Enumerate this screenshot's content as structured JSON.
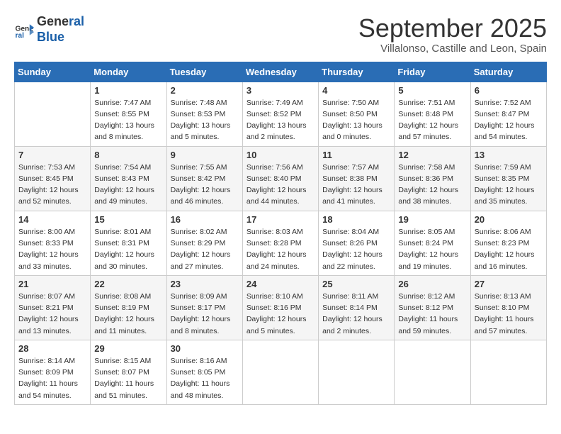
{
  "header": {
    "logo_line1": "General",
    "logo_line2": "Blue",
    "month_title": "September 2025",
    "subtitle": "Villalonso, Castille and Leon, Spain"
  },
  "weekdays": [
    "Sunday",
    "Monday",
    "Tuesday",
    "Wednesday",
    "Thursday",
    "Friday",
    "Saturday"
  ],
  "weeks": [
    [
      {
        "day": "",
        "info": ""
      },
      {
        "day": "1",
        "info": "Sunrise: 7:47 AM\nSunset: 8:55 PM\nDaylight: 13 hours\nand 8 minutes."
      },
      {
        "day": "2",
        "info": "Sunrise: 7:48 AM\nSunset: 8:53 PM\nDaylight: 13 hours\nand 5 minutes."
      },
      {
        "day": "3",
        "info": "Sunrise: 7:49 AM\nSunset: 8:52 PM\nDaylight: 13 hours\nand 2 minutes."
      },
      {
        "day": "4",
        "info": "Sunrise: 7:50 AM\nSunset: 8:50 PM\nDaylight: 13 hours\nand 0 minutes."
      },
      {
        "day": "5",
        "info": "Sunrise: 7:51 AM\nSunset: 8:48 PM\nDaylight: 12 hours\nand 57 minutes."
      },
      {
        "day": "6",
        "info": "Sunrise: 7:52 AM\nSunset: 8:47 PM\nDaylight: 12 hours\nand 54 minutes."
      }
    ],
    [
      {
        "day": "7",
        "info": "Sunrise: 7:53 AM\nSunset: 8:45 PM\nDaylight: 12 hours\nand 52 minutes."
      },
      {
        "day": "8",
        "info": "Sunrise: 7:54 AM\nSunset: 8:43 PM\nDaylight: 12 hours\nand 49 minutes."
      },
      {
        "day": "9",
        "info": "Sunrise: 7:55 AM\nSunset: 8:42 PM\nDaylight: 12 hours\nand 46 minutes."
      },
      {
        "day": "10",
        "info": "Sunrise: 7:56 AM\nSunset: 8:40 PM\nDaylight: 12 hours\nand 44 minutes."
      },
      {
        "day": "11",
        "info": "Sunrise: 7:57 AM\nSunset: 8:38 PM\nDaylight: 12 hours\nand 41 minutes."
      },
      {
        "day": "12",
        "info": "Sunrise: 7:58 AM\nSunset: 8:36 PM\nDaylight: 12 hours\nand 38 minutes."
      },
      {
        "day": "13",
        "info": "Sunrise: 7:59 AM\nSunset: 8:35 PM\nDaylight: 12 hours\nand 35 minutes."
      }
    ],
    [
      {
        "day": "14",
        "info": "Sunrise: 8:00 AM\nSunset: 8:33 PM\nDaylight: 12 hours\nand 33 minutes."
      },
      {
        "day": "15",
        "info": "Sunrise: 8:01 AM\nSunset: 8:31 PM\nDaylight: 12 hours\nand 30 minutes."
      },
      {
        "day": "16",
        "info": "Sunrise: 8:02 AM\nSunset: 8:29 PM\nDaylight: 12 hours\nand 27 minutes."
      },
      {
        "day": "17",
        "info": "Sunrise: 8:03 AM\nSunset: 8:28 PM\nDaylight: 12 hours\nand 24 minutes."
      },
      {
        "day": "18",
        "info": "Sunrise: 8:04 AM\nSunset: 8:26 PM\nDaylight: 12 hours\nand 22 minutes."
      },
      {
        "day": "19",
        "info": "Sunrise: 8:05 AM\nSunset: 8:24 PM\nDaylight: 12 hours\nand 19 minutes."
      },
      {
        "day": "20",
        "info": "Sunrise: 8:06 AM\nSunset: 8:23 PM\nDaylight: 12 hours\nand 16 minutes."
      }
    ],
    [
      {
        "day": "21",
        "info": "Sunrise: 8:07 AM\nSunset: 8:21 PM\nDaylight: 12 hours\nand 13 minutes."
      },
      {
        "day": "22",
        "info": "Sunrise: 8:08 AM\nSunset: 8:19 PM\nDaylight: 12 hours\nand 11 minutes."
      },
      {
        "day": "23",
        "info": "Sunrise: 8:09 AM\nSunset: 8:17 PM\nDaylight: 12 hours\nand 8 minutes."
      },
      {
        "day": "24",
        "info": "Sunrise: 8:10 AM\nSunset: 8:16 PM\nDaylight: 12 hours\nand 5 minutes."
      },
      {
        "day": "25",
        "info": "Sunrise: 8:11 AM\nSunset: 8:14 PM\nDaylight: 12 hours\nand 2 minutes."
      },
      {
        "day": "26",
        "info": "Sunrise: 8:12 AM\nSunset: 8:12 PM\nDaylight: 11 hours\nand 59 minutes."
      },
      {
        "day": "27",
        "info": "Sunrise: 8:13 AM\nSunset: 8:10 PM\nDaylight: 11 hours\nand 57 minutes."
      }
    ],
    [
      {
        "day": "28",
        "info": "Sunrise: 8:14 AM\nSunset: 8:09 PM\nDaylight: 11 hours\nand 54 minutes."
      },
      {
        "day": "29",
        "info": "Sunrise: 8:15 AM\nSunset: 8:07 PM\nDaylight: 11 hours\nand 51 minutes."
      },
      {
        "day": "30",
        "info": "Sunrise: 8:16 AM\nSunset: 8:05 PM\nDaylight: 11 hours\nand 48 minutes."
      },
      {
        "day": "",
        "info": ""
      },
      {
        "day": "",
        "info": ""
      },
      {
        "day": "",
        "info": ""
      },
      {
        "day": "",
        "info": ""
      }
    ]
  ]
}
